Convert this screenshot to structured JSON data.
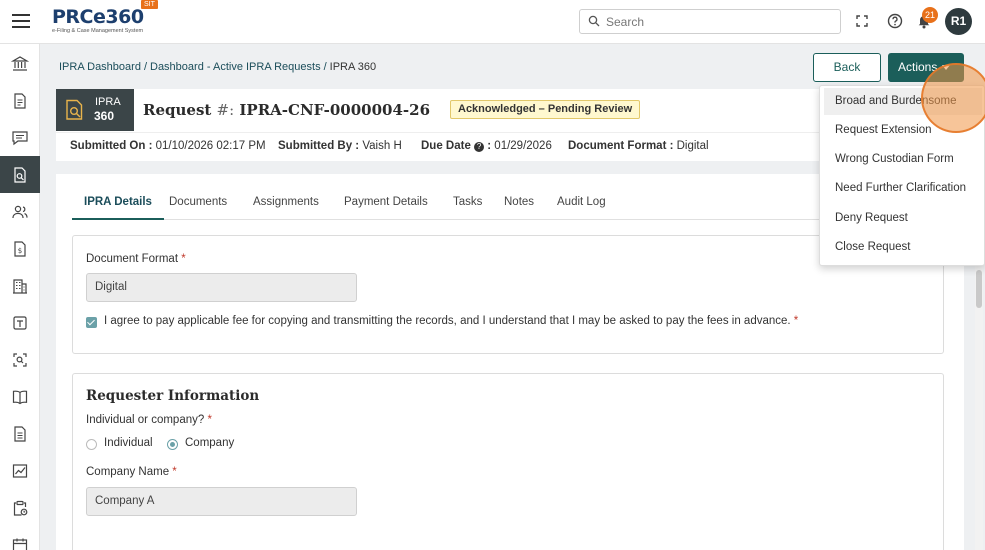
{
  "app": {
    "logo_text": "PRCe360",
    "logo_tagline": "e-Filing & Case Management System",
    "env_badge": "SIT"
  },
  "topbar": {
    "search_placeholder": "Search",
    "notification_count": "21",
    "avatar_initials": "R1"
  },
  "breadcrumb": {
    "items": [
      "IPRA Dashboard",
      "Dashboard - Active IPRA Requests",
      "IPRA 360"
    ]
  },
  "buttons": {
    "back": "Back",
    "actions": "Actions"
  },
  "request": {
    "tile_line1": "IPRA",
    "tile_line2": "360",
    "title_prefix": "Request ",
    "title_hash": "#:",
    "title_id": " IPRA-CNF-0000004-26",
    "status": "Acknowledged – Pending Review"
  },
  "meta": {
    "submitted_on_label": "Submitted On :",
    "submitted_on": "01/10/2026 02:17 PM",
    "submitted_by_label": "Submitted By :",
    "submitted_by": "Vaish H",
    "due_date_label": "Due Date",
    "due_date": "01/29/2026",
    "doc_format_label": "Document Format :",
    "doc_format": "Digital"
  },
  "tabs": [
    "IPRA Details",
    "Documents",
    "Assignments",
    "Payment Details",
    "Tasks",
    "Notes",
    "Audit Log"
  ],
  "doc_section": {
    "label": "Document Format",
    "value": "Digital",
    "agree_text": "I agree to pay applicable fee for copying and transmitting the records, and I understand that I may be asked to pay the fees in advance."
  },
  "requester": {
    "title": "Requester Information",
    "type_label": "Individual or company?",
    "option_individual": "Individual",
    "option_company": "Company",
    "selected": "Company",
    "company_label": "Company Name",
    "company_value": "Company A"
  },
  "actions_menu": {
    "items": [
      "Broad and Burdensome",
      "Request Extension",
      "Wrong Custodian Form",
      "Need Further Clarification",
      "Deny Request",
      "Close Request"
    ]
  },
  "colors": {
    "primary": "#1b5e5a",
    "sidebar_active": "#3b4548",
    "accent_orange": "#e8711a",
    "status_badge_bg": "#fff8cf"
  }
}
